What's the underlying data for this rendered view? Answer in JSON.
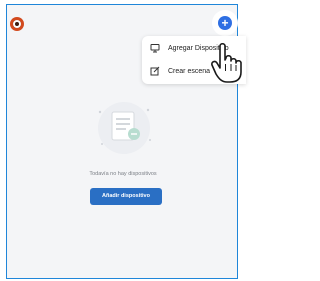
{
  "menu": {
    "items": [
      {
        "label": "Agregar Dispositivo",
        "icon": "monitor-icon"
      },
      {
        "label": "Crear escena",
        "icon": "edit-scene-icon"
      }
    ]
  },
  "empty_state": {
    "text": "Todavía no hay dispositivos",
    "button_label": "Añadir dispositivo"
  },
  "colors": {
    "accent": "#2f6fe3",
    "button": "#2a6fc4",
    "frame_border": "#1f86d9",
    "logo": "#d24a1e"
  }
}
